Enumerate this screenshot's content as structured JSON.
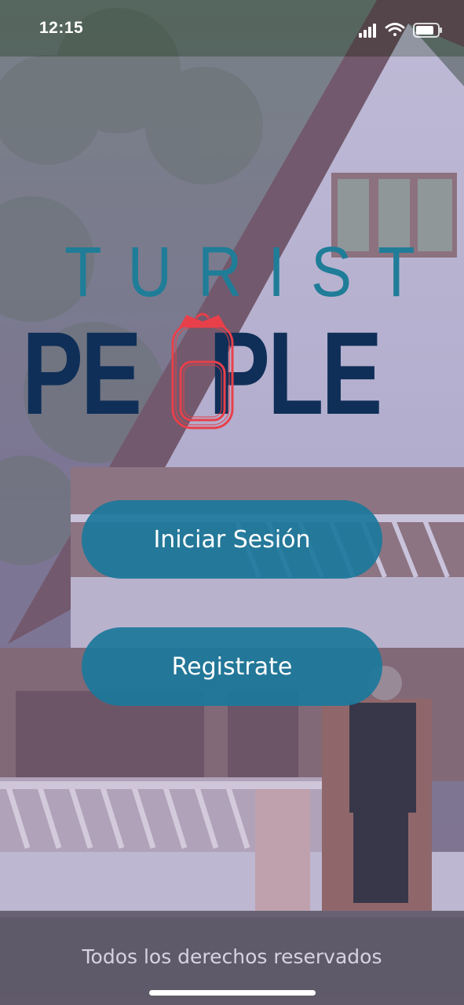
{
  "status_bar": {
    "time": "12:15",
    "icons": [
      "signal-icon",
      "wifi-icon",
      "battery-icon"
    ]
  },
  "logo": {
    "line1": "TURIST",
    "line2_prefix": "PE",
    "line2_suffix": "PLE",
    "emblem": "backpack-icon",
    "colors": {
      "turist": "#1f7d98",
      "people": "#0f2f58",
      "backpack": "#e8404a"
    }
  },
  "actions": {
    "login_label": "Iniciar Sesión",
    "register_label": "Registrate"
  },
  "footer": {
    "copyright": "Todos los derechos reservados"
  },
  "theme": {
    "button_color": "#1b789b",
    "overlay_color": "#968cb9"
  }
}
